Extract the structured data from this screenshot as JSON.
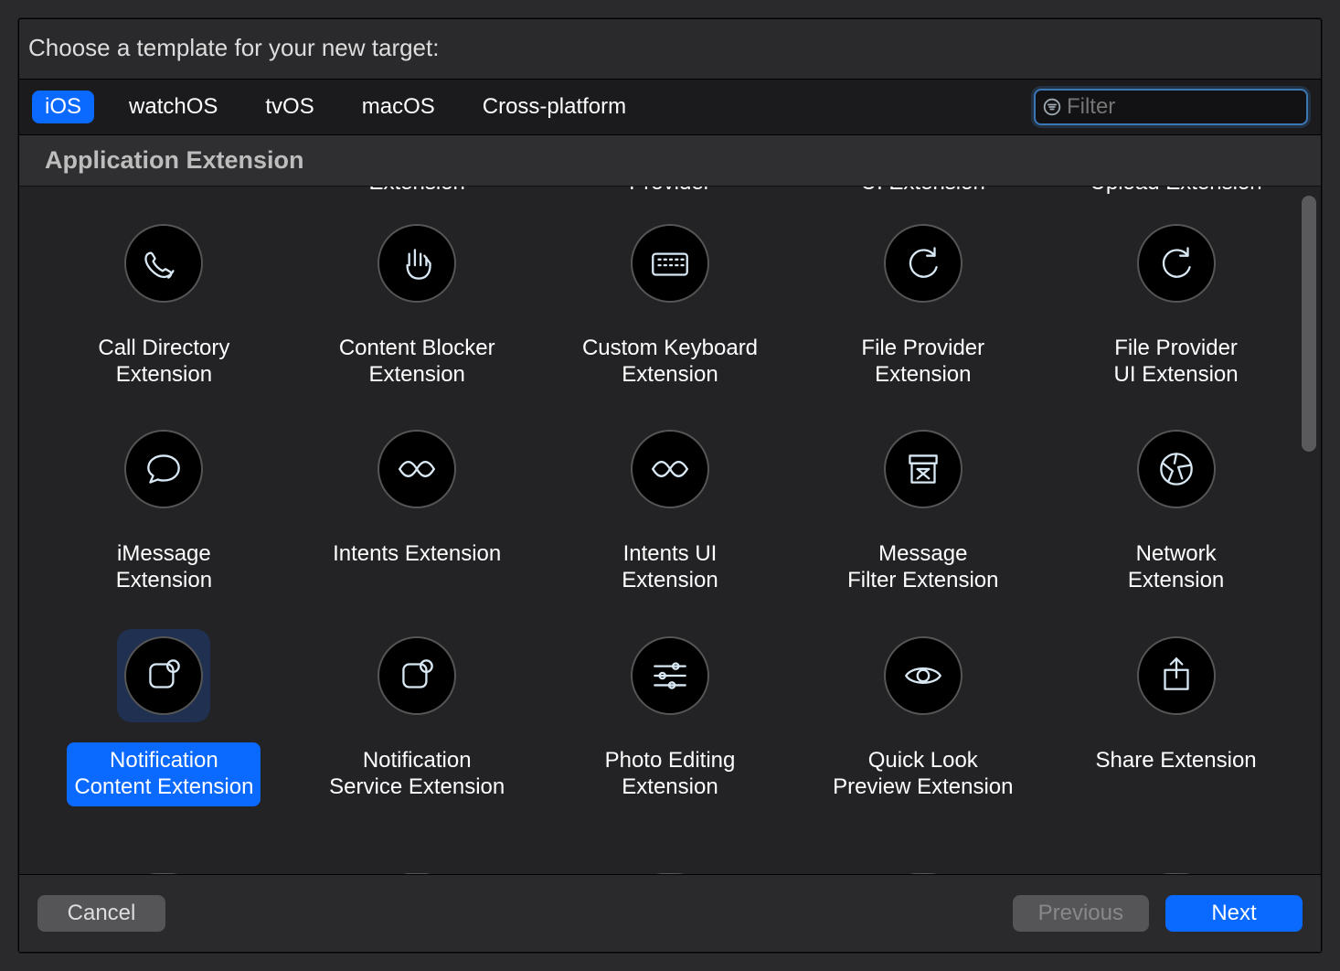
{
  "title": "Choose a template for your new target:",
  "tabs": [
    "iOS",
    "watchOS",
    "tvOS",
    "macOS",
    "Cross-platform"
  ],
  "activeTab": "iOS",
  "filter": {
    "placeholder": "Filter",
    "value": ""
  },
  "sectionHeader": "Application Extension",
  "partialTop": [
    "Extension",
    "Provider",
    "UI Extension",
    "Upload Extension"
  ],
  "row1": [
    {
      "label": "Call Directory\nExtension",
      "icon": "phone"
    },
    {
      "label": "Content Blocker\nExtension",
      "icon": "hand"
    },
    {
      "label": "Custom Keyboard\nExtension",
      "icon": "keyboard"
    },
    {
      "label": "File Provider\nExtension",
      "icon": "cycle"
    },
    {
      "label": "File Provider\nUI Extension",
      "icon": "cycle"
    }
  ],
  "row2": [
    {
      "label": "iMessage\nExtension",
      "icon": "bubble"
    },
    {
      "label": "Intents Extension",
      "icon": "wave"
    },
    {
      "label": "Intents UI\nExtension",
      "icon": "wave"
    },
    {
      "label": "Message\nFilter Extension",
      "icon": "archive"
    },
    {
      "label": "Network\nExtension",
      "icon": "globe"
    }
  ],
  "row3": [
    {
      "label": "Notification\nContent Extension",
      "icon": "notif",
      "selected": true
    },
    {
      "label": "Notification\nService Extension",
      "icon": "notif"
    },
    {
      "label": "Photo Editing\nExtension",
      "icon": "sliders"
    },
    {
      "label": "Quick Look\nPreview Extension",
      "icon": "eye"
    },
    {
      "label": "Share Extension",
      "icon": "share"
    }
  ],
  "partialBottomIcons": [
    "circle",
    "grid4",
    "rect",
    "num17",
    "rect"
  ],
  "buttons": {
    "cancel": "Cancel",
    "previous": "Previous",
    "next": "Next"
  }
}
